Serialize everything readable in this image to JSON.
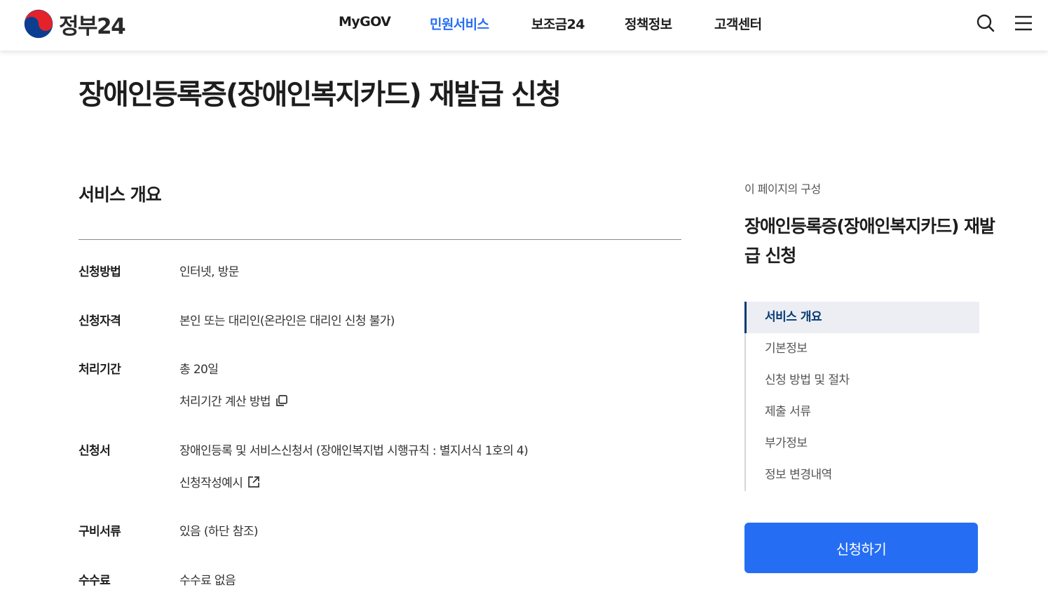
{
  "header": {
    "logo_text": "정부24",
    "nav": [
      "MyGOV",
      "민원서비스",
      "보조금24",
      "정책정보",
      "고객센터"
    ],
    "active_nav": "민원서비스",
    "search_icon": "search-icon",
    "menu_icon": "hamburger-menu-icon"
  },
  "page": {
    "title": "장애인등록증(장애인복지카드) 재발급 신청"
  },
  "overview": {
    "heading": "서비스 개요",
    "rows": [
      {
        "label": "신청방법",
        "value": "인터넷, 방문"
      },
      {
        "label": "신청자격",
        "value": "본인 또는 대리인(온라인은 대리인 신청 불가)"
      },
      {
        "label": "처리기간",
        "value": "총 20일",
        "link": "처리기간 계산 방법",
        "link_icon": "copy-icon"
      },
      {
        "label": "신청서",
        "value": "장애인등록 및 서비스신청서 (장애인복지법 시행규칙 : 별지서식 1호의 4)",
        "link": "신청작성예시",
        "link_icon": "external-link-icon"
      },
      {
        "label": "구비서류",
        "value": "있음 (하단 참조)"
      },
      {
        "label": "수수료",
        "value": "수수료 없음"
      }
    ]
  },
  "aside": {
    "caption": "이 페이지의 구성",
    "title": "장애인등록증(장애인복지카드) 재발급 신청",
    "toc": [
      "서비스 개요",
      "기본정보",
      "신청 방법 및 절차",
      "제출 서류",
      "부가정보",
      "정보 변경내역"
    ],
    "active_toc": "서비스 개요",
    "apply_button": "신청하기"
  },
  "colors": {
    "brand_blue": "#256ef4",
    "active_toc_navy": "#063a74",
    "toc_active_bg": "#eceef3"
  }
}
